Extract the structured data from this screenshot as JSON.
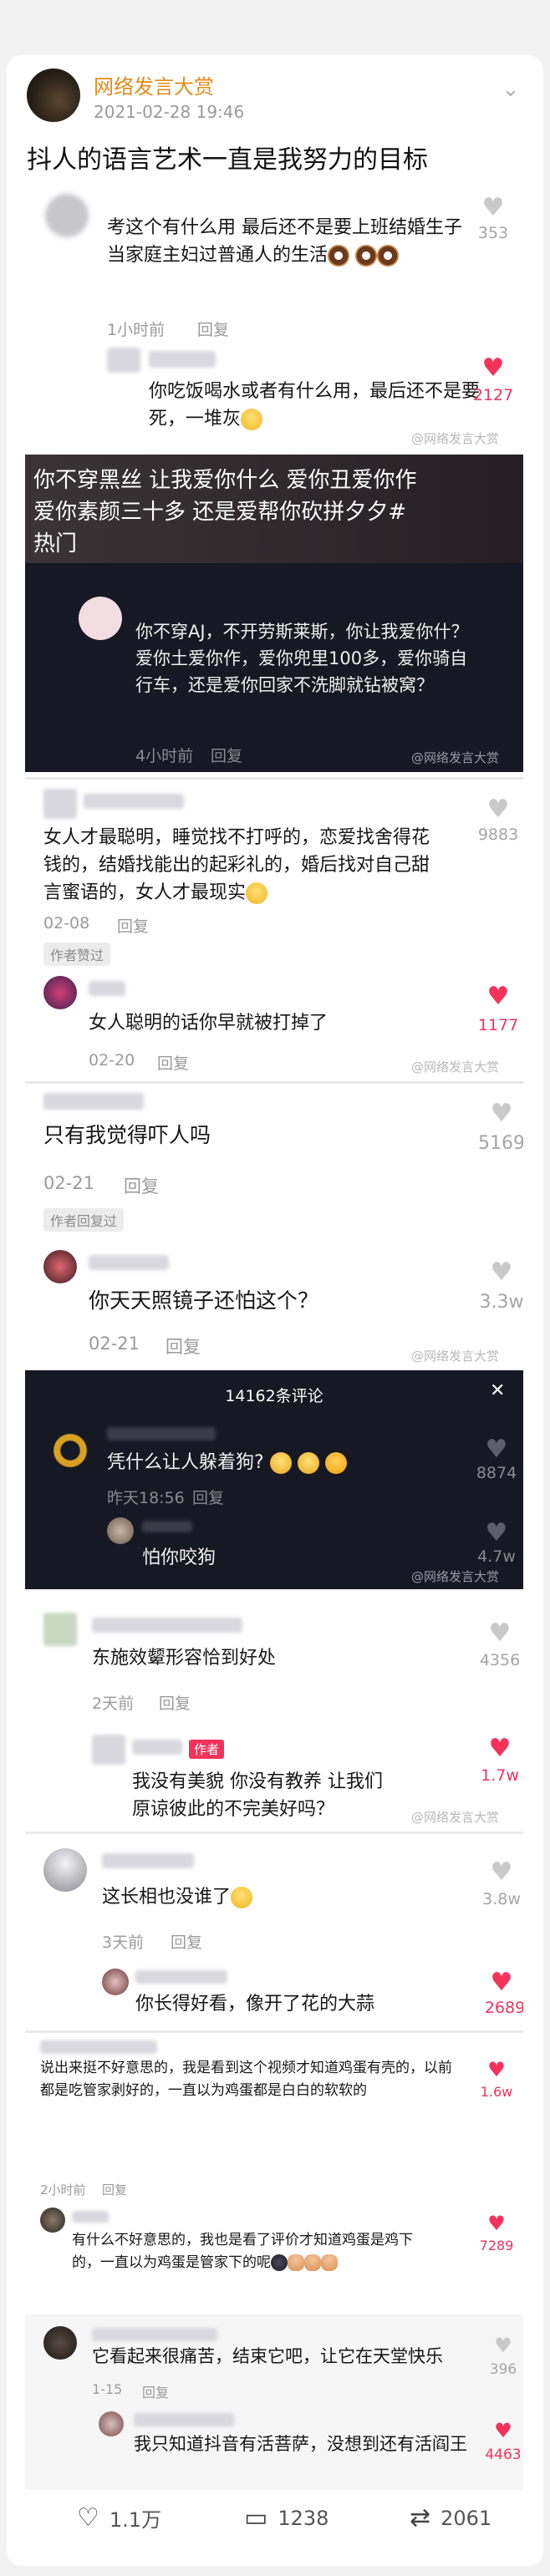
{
  "post": {
    "author": "网络发言大赏",
    "time": "2021-02-28 19:46",
    "text": "抖人的语言艺术一直是我努力的目标"
  },
  "watermark": "@网络发言大赏",
  "shot1": {
    "c1_text": "考这个有什么用 最后还不是要上班结婚生子 当家庭主妇过普通人的生活",
    "c1_time": "1小时前",
    "c1_reply": "回复",
    "c1_likes": "353",
    "r1_text": "你吃饭喝水或者有什么用，最后还不是要死，一堆灰",
    "r1_likes": "2127"
  },
  "shot2": {
    "banner_l1": "你不穿黑丝 让我爱你什么 爱你丑爱你作",
    "banner_l2": "爱你素颜三十多 还是爱帮你砍拼夕夕#",
    "banner_l3": "热门",
    "text": "你不穿AJ，不开劳斯莱斯，你让我爱你什？爱你土爱你作，爱你兜里100多，爱你骑自行车，还是爱你回家不洗脚就钻被窝？",
    "time": "4小时前",
    "reply": "回复"
  },
  "shot3": {
    "c_text": "女人才最聪明，睡觉找不打呼的，恋爱找舍得花钱的，结婚找能出的起彩礼的，婚后找对自己甜言蜜语的，女人才最现实",
    "c_time": "02-08",
    "c_reply": "回复",
    "c_badge": "作者赞过",
    "c_likes": "9883",
    "r_text": "女人聪明的话你早就被打掉了",
    "r_time": "02-20",
    "r_reply": "回复",
    "r_likes": "1177"
  },
  "shot4": {
    "c_text": "只有我觉得吓人吗",
    "c_time": "02-21",
    "c_reply": "回复",
    "c_badge": "作者回复过",
    "c_likes": "5169",
    "r_text": "你天天照镜子还怕这个？",
    "r_time": "02-21",
    "r_reply": "回复",
    "r_likes": "3.3w"
  },
  "shot5": {
    "count_label": "14162条评论",
    "close": "✕",
    "c_text": "凭什么让人躲着狗?",
    "c_time": "昨天18:56",
    "c_reply": "回复",
    "c_likes": "8874",
    "r_text": "怕你咬狗",
    "r_likes": "4.7w"
  },
  "shot6": {
    "c_text": "东施效颦形容恰到好处",
    "c_time": "2天前",
    "c_reply": "回复",
    "c_likes": "4356",
    "author_tag": "作者",
    "r_text": "我没有美貌 你没有教养 让我们原谅彼此的不完美好吗？",
    "r_likes": "1.7w"
  },
  "shot7": {
    "c_text": "这长相也没谁了",
    "c_time": "3天前",
    "c_reply": "回复",
    "c_likes": "3.8w",
    "r_text": "你长得好看，像开了花的大蒜",
    "r_likes": "2689"
  },
  "shot8": {
    "c_text": "说出来挺不好意思的，我是看到这个视频才知道鸡蛋有壳的，以前都是吃管家剥好的，一直以为鸡蛋都是白白的软软的",
    "c_time": "2小时前",
    "c_reply": "回复",
    "c_likes": "1.6w",
    "r_text": "有什么不好意思的，我也是看了评价才知道鸡蛋是鸡下的，一直以为鸡蛋是管家下的呢",
    "r_likes": "7289"
  },
  "shot9": {
    "c_text": "它看起来很痛苦，结束它吧，让它在天堂快乐",
    "c_time": "1-15",
    "c_reply": "回复",
    "c_likes": "396",
    "r_text": "我只知道抖音有活菩萨，没想到还有活阎王",
    "r_likes": "4463"
  },
  "footer": {
    "likes": "1.1万",
    "comments": "1238",
    "reposts": "2061"
  },
  "colors": {
    "brand": "#e58a1a",
    "like_red": "#f4325c",
    "dark_bg": "#161823"
  },
  "icons": [
    "chevron-down-icon",
    "heart-icon",
    "comment-icon",
    "repost-icon",
    "close-icon"
  ]
}
